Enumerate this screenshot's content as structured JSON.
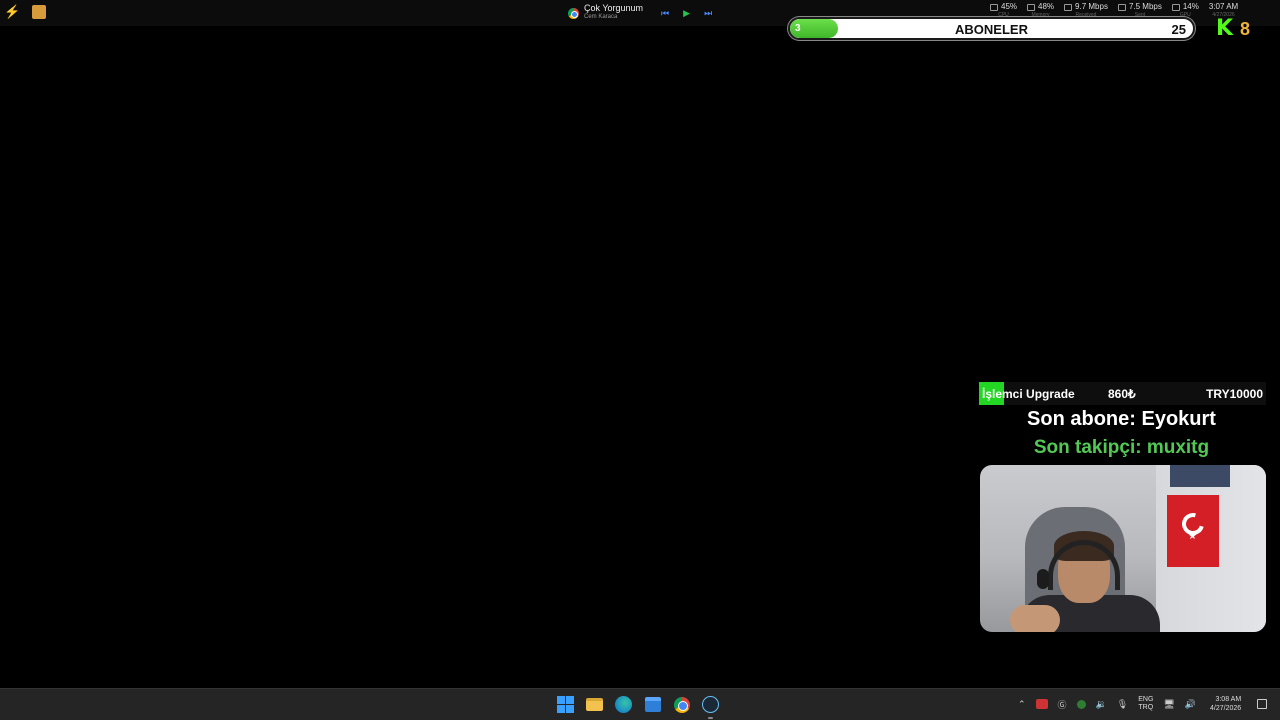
{
  "topbar": {
    "media": {
      "title": "Çok Yorgunum",
      "artist": "Cem Karaca",
      "prev_icon": "skip-previous-icon",
      "play_icon": "play-icon",
      "next_icon": "skip-next-icon"
    },
    "stats": [
      {
        "icon": "cpu-icon",
        "value": "45%",
        "sub": "CPU"
      },
      {
        "icon": "memory-icon",
        "value": "48%",
        "sub": "Memory"
      },
      {
        "icon": "download-icon",
        "value": "9.7 Mbps",
        "sub": "Received"
      },
      {
        "icon": "upload-icon",
        "value": "7.5 Mbps",
        "sub": "Sent"
      },
      {
        "icon": "gpu-icon",
        "value": "14%",
        "sub": "GPU"
      }
    ],
    "clock": {
      "time": "3:07 AM",
      "date": "4/27/2026"
    }
  },
  "subscriber_goal": {
    "label": "ABONELER",
    "current": "3",
    "goal": "25",
    "progress": 0.12,
    "fill_color": "#4fcf35"
  },
  "kick": {
    "logo": "K",
    "count": "8",
    "brand_color": "#53fc18"
  },
  "donation": {
    "title": "İşlemci Upgrade",
    "current": "860₺",
    "target": "TRY10000",
    "progress": 0.086,
    "fill_color": "#23d623"
  },
  "last_sub": "Son abone: Eyokurt",
  "last_follow": "Son takipçi: muxitg",
  "taskbar": {
    "apps": [
      "start-icon",
      "file-explorer-icon",
      "edge-icon",
      "store-icon",
      "chrome-icon",
      "steam-icon"
    ],
    "lang_top": "ENG",
    "lang_bottom": "TRQ",
    "clock_time": "3:08 AM",
    "clock_date": "4/27/2026"
  }
}
